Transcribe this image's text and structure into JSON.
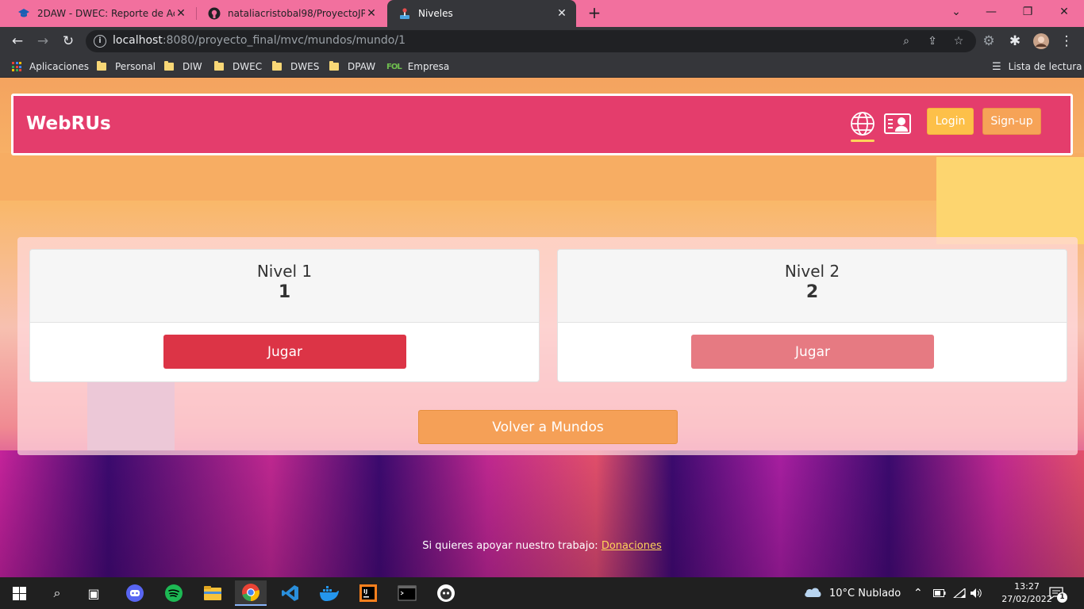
{
  "browser": {
    "tabs": [
      {
        "title": "2DAW - DWEC: Reporte de Activi",
        "icon": "graduation-cap-icon"
      },
      {
        "title": "nataliacristobal98/ProyectoJPA: P",
        "icon": "github-icon"
      },
      {
        "title": "Niveles",
        "icon": "joystick-icon",
        "active": true
      }
    ],
    "url_host": "localhost",
    "url_rest": ":8080/proyecto_final/mvc/mundos/mundo/1",
    "bookmarks": [
      "Aplicaciones",
      "Personal",
      "DIW",
      "DWEC",
      "DWES",
      "DPAW",
      "Empresa"
    ],
    "fol_badge": "FOL",
    "reading_list": "Lista de lectura"
  },
  "site": {
    "brand": "WebRUs",
    "login": "Login",
    "signup": "Sign-up",
    "levels": [
      {
        "title": "Nivel 1",
        "number": "1",
        "button": "Jugar"
      },
      {
        "title": "Nivel 2",
        "number": "2",
        "button": "Jugar"
      }
    ],
    "back_button": "Volver a Mundos",
    "footer_text": "Si quieres apoyar nuestro trabajo:",
    "footer_link": "Donaciones"
  },
  "taskbar": {
    "weather": "10°C  Nublado",
    "time": "13:27",
    "date": "27/02/2022",
    "notifications": "1"
  },
  "colors": {
    "navbar": "#e43d6c",
    "play_primary": "#dc3446",
    "play_secondary": "#e67a82",
    "back": "#f5a057",
    "tab_strip": "#f2709e"
  }
}
